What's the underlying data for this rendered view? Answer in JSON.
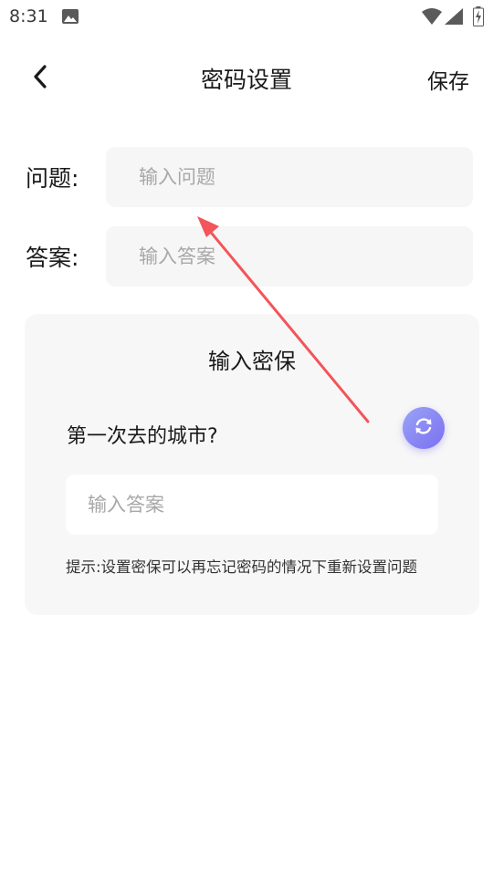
{
  "status_bar": {
    "time": "8:31",
    "icons": [
      "photo-icon",
      "wifi-icon",
      "signal-icon",
      "battery-charging-icon"
    ]
  },
  "header": {
    "back_icon": "chevron-left-icon",
    "title": "密码设置",
    "save_label": "保存"
  },
  "form": {
    "question_label": "问题:",
    "question_placeholder": "输入问题",
    "answer_label": "答案:",
    "answer_placeholder": "输入答案"
  },
  "security_card": {
    "title": "输入密保",
    "question": "第一次去的城市?",
    "refresh_icon": "refresh-icon",
    "answer_placeholder": "输入答案",
    "hint": "提示:设置密保可以再忘记密码的情况下重新设置问题"
  },
  "colors": {
    "accent_gradient_start": "#9aa4f7",
    "accent_gradient_end": "#7b6ff0",
    "annotation_arrow": "#f2555a",
    "input_bg": "#f6f6f6",
    "card_bg": "#f7f7f7"
  }
}
